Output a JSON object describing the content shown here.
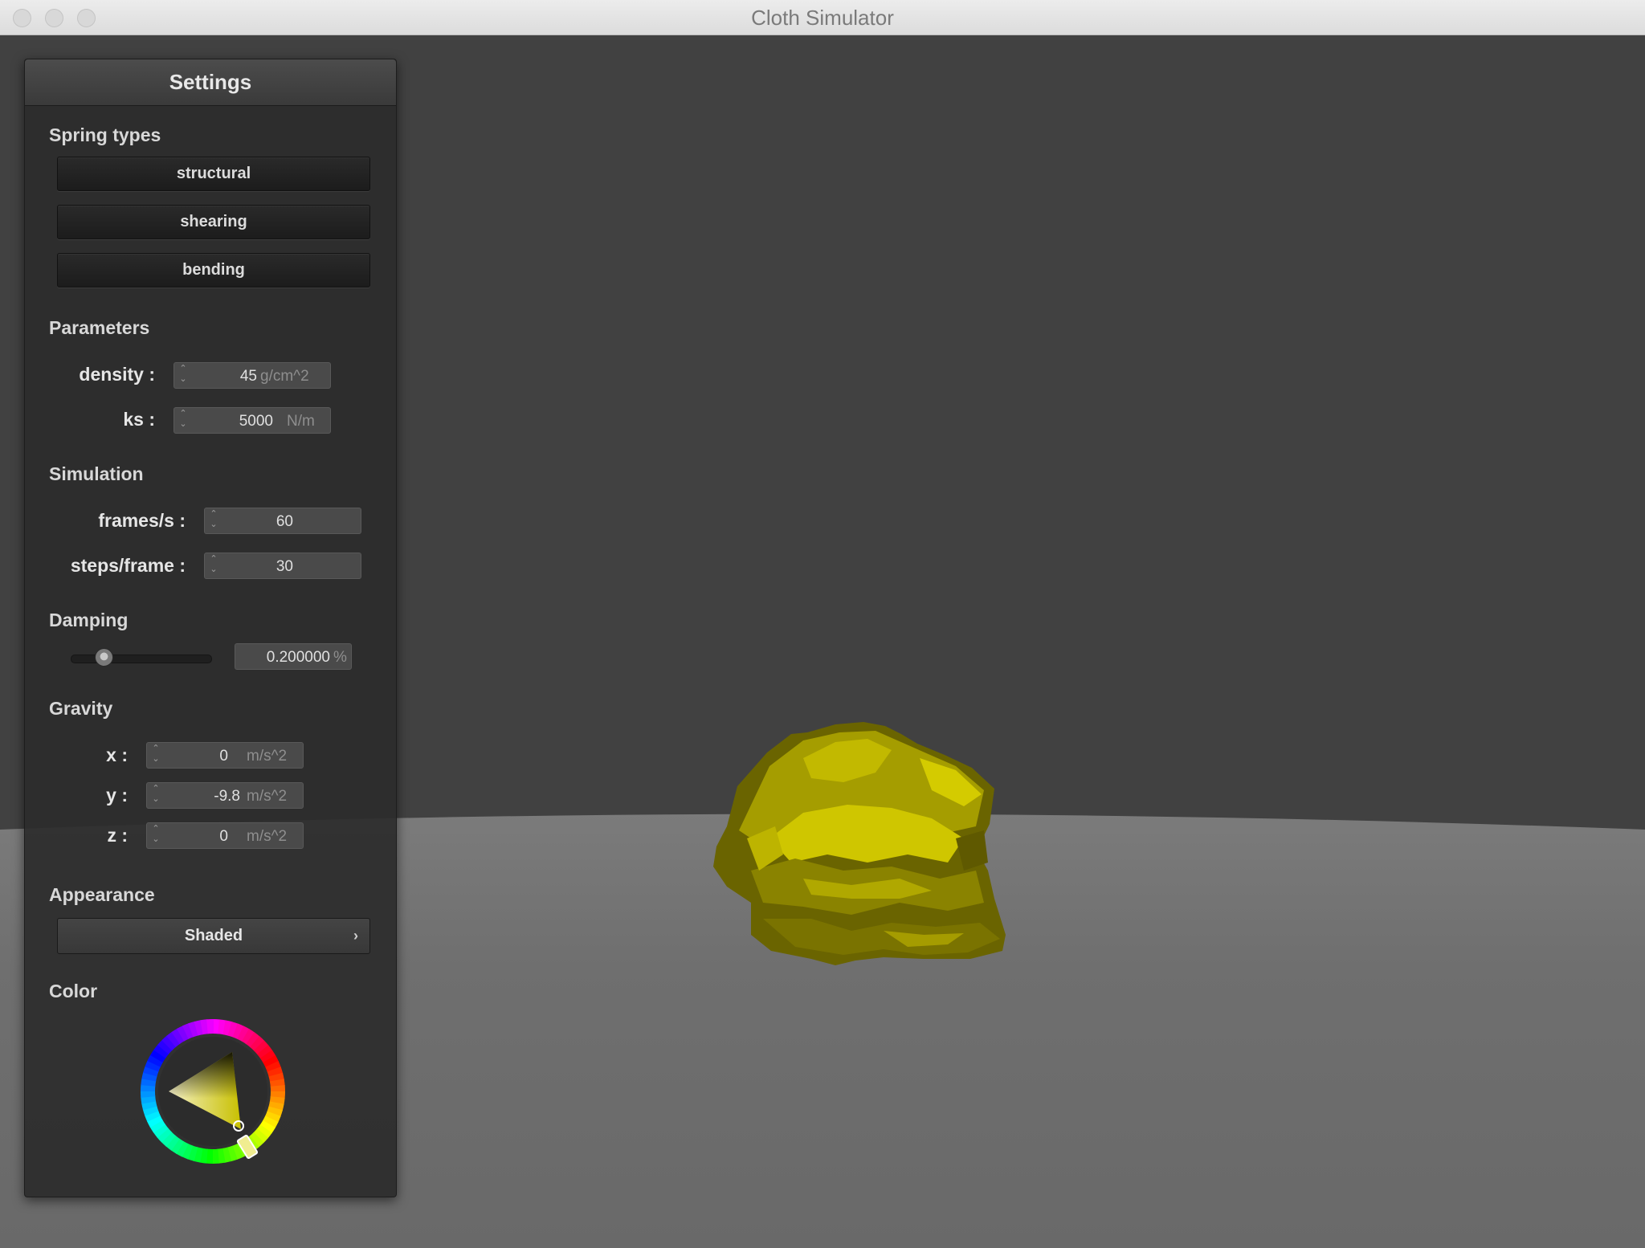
{
  "window": {
    "title": "Cloth Simulator"
  },
  "panel": {
    "title": "Settings",
    "spring_types": {
      "heading": "Spring types",
      "buttons": [
        "structural",
        "shearing",
        "bending"
      ]
    },
    "parameters": {
      "heading": "Parameters",
      "density": {
        "label": "density :",
        "value": "45",
        "unit": "g/cm^2"
      },
      "ks": {
        "label": "ks :",
        "value": "5000",
        "unit": "N/m"
      }
    },
    "simulation": {
      "heading": "Simulation",
      "fps": {
        "label": "frames/s :",
        "value": "60"
      },
      "steps": {
        "label": "steps/frame :",
        "value": "30"
      }
    },
    "damping": {
      "heading": "Damping",
      "value": "0.200000",
      "unit": "%",
      "slider_fraction": 0.2
    },
    "gravity": {
      "heading": "Gravity",
      "x": {
        "label": "x :",
        "value": "0",
        "unit": "m/s^2"
      },
      "y": {
        "label": "y :",
        "value": "-9.8",
        "unit": "m/s^2"
      },
      "z": {
        "label": "z :",
        "value": "0",
        "unit": "m/s^2"
      }
    },
    "appearance": {
      "heading": "Appearance",
      "selected": "Shaded",
      "icon": "chevron-right-icon"
    },
    "color": {
      "heading": "Color",
      "selected_hex": "#c8c000"
    }
  },
  "scene": {
    "background_color": "#414141",
    "floor_color": "#6d6d6d",
    "cloth_color": "#c8c000"
  }
}
